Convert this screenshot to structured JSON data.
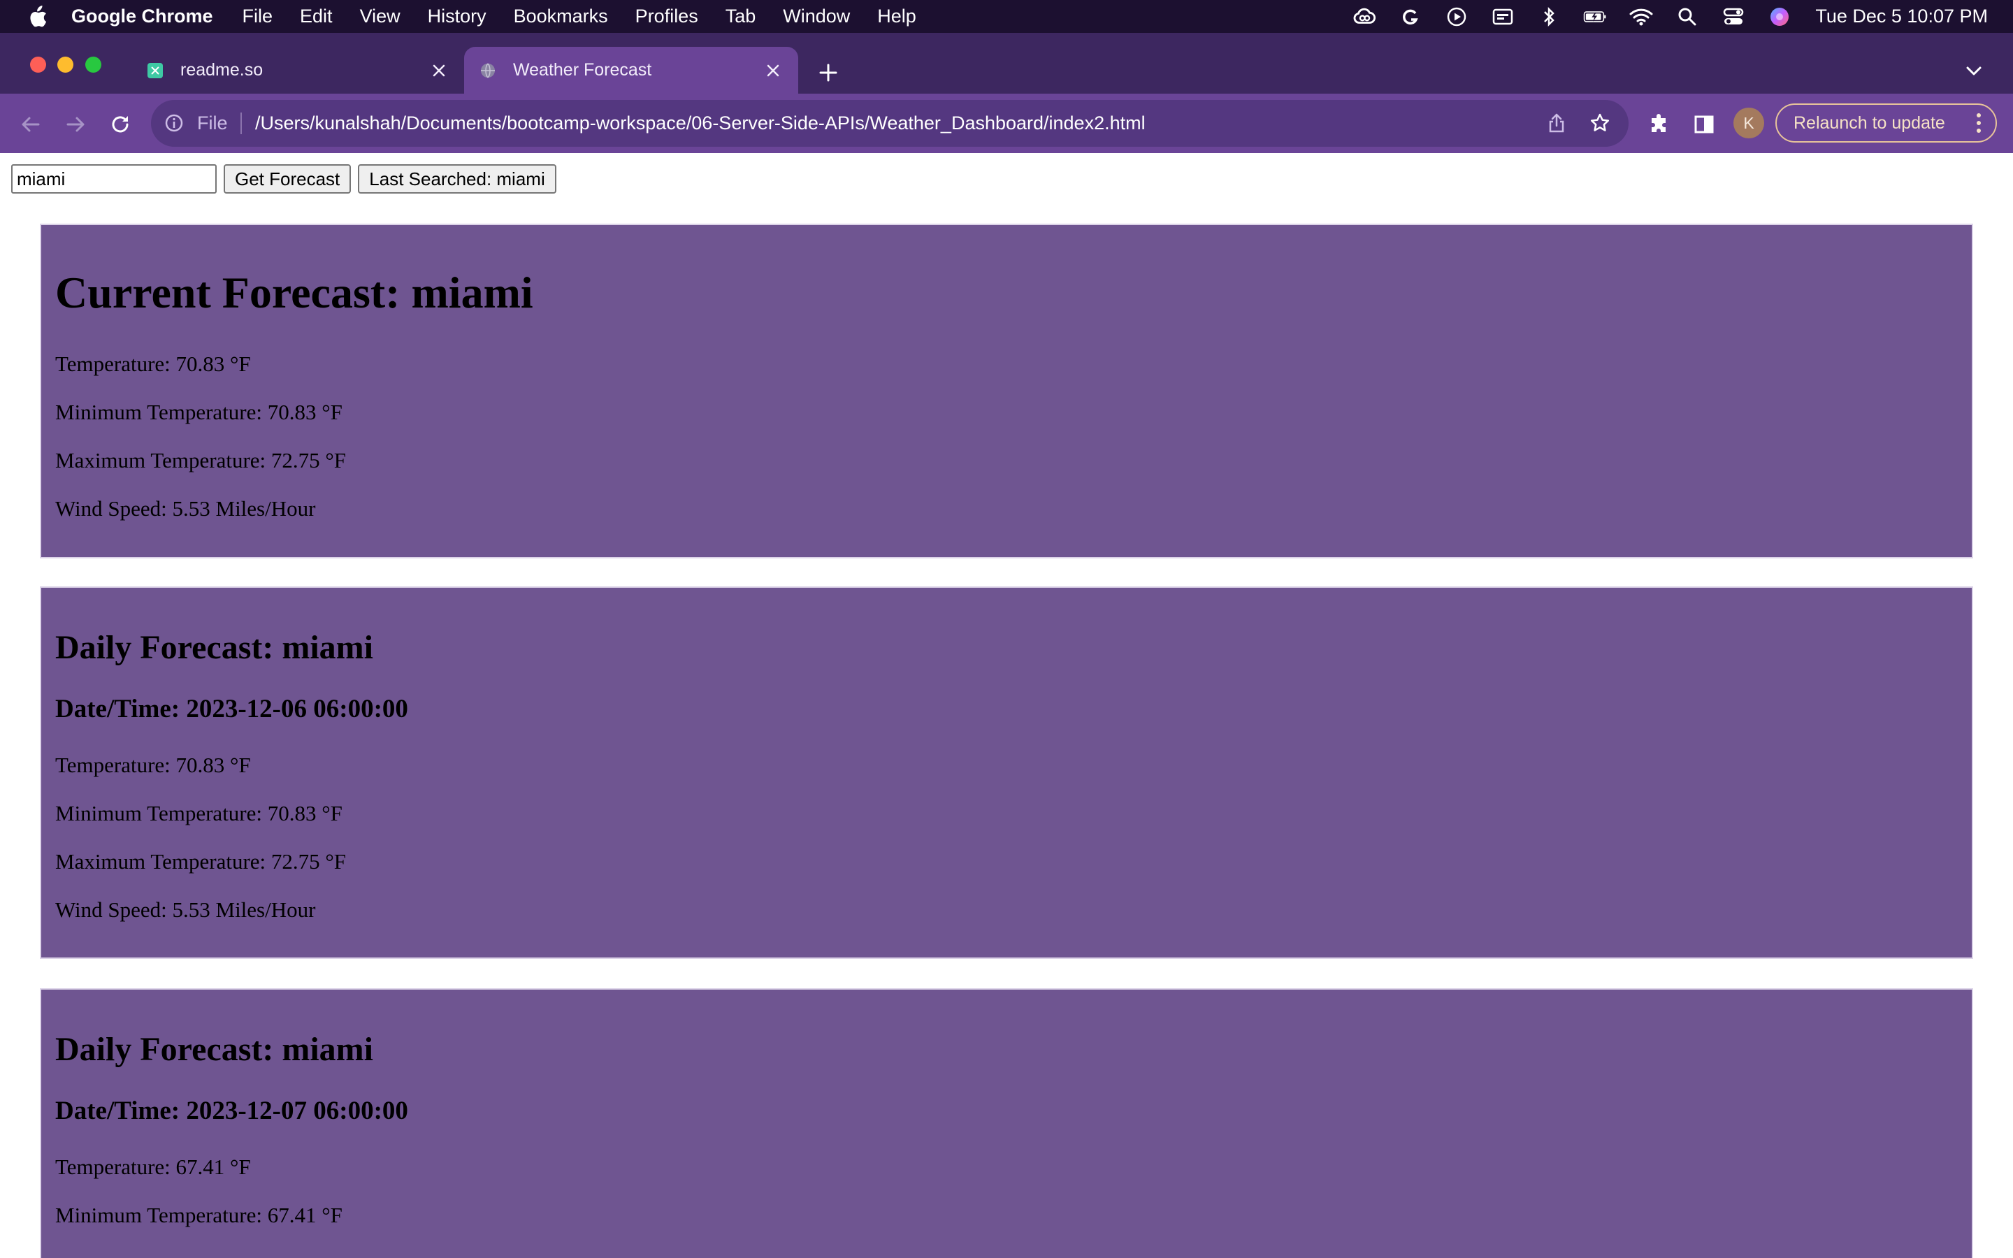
{
  "menubar": {
    "app_name": "Google Chrome",
    "items": [
      "File",
      "Edit",
      "View",
      "History",
      "Bookmarks",
      "Profiles",
      "Tab",
      "Window",
      "Help"
    ],
    "clock": "Tue Dec 5  10:07 PM"
  },
  "tabs": [
    {
      "title": "readme.so",
      "favicon": "readme-favicon-icon",
      "active": false
    },
    {
      "title": "Weather Forecast",
      "favicon": "globe-icon",
      "active": true
    }
  ],
  "omnibox": {
    "scheme_label": "File",
    "url": "/Users/kunalshah/Documents/bootcamp-workspace/06-Server-Side-APIs/Weather_Dashboard/index2.html"
  },
  "profile": {
    "initial": "K"
  },
  "relaunch_label": "Relaunch to update",
  "colors": {
    "chrome_frame": "#3d2760",
    "toolbar": "#6a4497",
    "card_background": "#6f5591",
    "menubar": "#1c1030"
  },
  "search": {
    "value": "miami",
    "submit_label": "Get Forecast",
    "last_searched_label": "Last Searched: miami"
  },
  "current": {
    "heading": "Current Forecast: miami",
    "temperature": "Temperature: 70.83 °F",
    "min_temperature": "Minimum Temperature: 70.83 °F",
    "max_temperature": "Maximum Temperature: 72.75 °F",
    "wind": "Wind Speed: 5.53 Miles/Hour"
  },
  "daily": [
    {
      "heading": "Daily Forecast: miami",
      "datetime": "Date/Time: 2023-12-06 06:00:00",
      "temperature": "Temperature: 70.83 °F",
      "min_temperature": "Minimum Temperature: 70.83 °F",
      "max_temperature": "Maximum Temperature: 72.75 °F",
      "wind": "Wind Speed: 5.53 Miles/Hour"
    },
    {
      "heading": "Daily Forecast: miami",
      "datetime": "Date/Time: 2023-12-07 06:00:00",
      "temperature": "Temperature: 67.41 °F",
      "min_temperature": "Minimum Temperature: 67.41 °F"
    }
  ]
}
